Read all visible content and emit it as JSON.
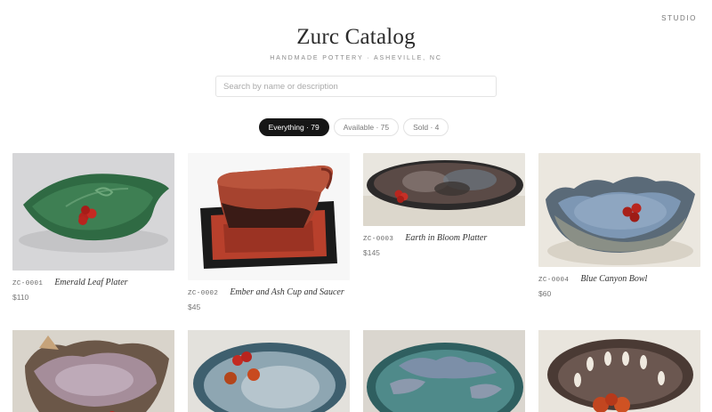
{
  "nav": {
    "studio_label": "STUDIO"
  },
  "header": {
    "title": "Zurc Catalog",
    "subtitle": "HANDMADE POTTERY · ASHEVILLE, NC"
  },
  "search": {
    "placeholder": "Search by name or description",
    "value": ""
  },
  "filters": [
    {
      "label": "Everything · 79",
      "active": true
    },
    {
      "label": "Available · 75",
      "active": false
    },
    {
      "label": "Sold · 4",
      "active": false
    }
  ],
  "products": [
    {
      "sku": "ZC-0001",
      "name": "Emerald Leaf Plater",
      "price": "$110"
    },
    {
      "sku": "ZC-0002",
      "name": "Ember and Ash Cup and Saucer",
      "price": "$45"
    },
    {
      "sku": "ZC-0003",
      "name": "Earth in Bloom Platter",
      "price": "$145"
    },
    {
      "sku": "ZC-0004",
      "name": "Blue Canyon Bowl",
      "price": "$60"
    }
  ],
  "colors": {
    "accent": "#161616",
    "background": "#ffffff",
    "border": "#e2e2e2"
  }
}
